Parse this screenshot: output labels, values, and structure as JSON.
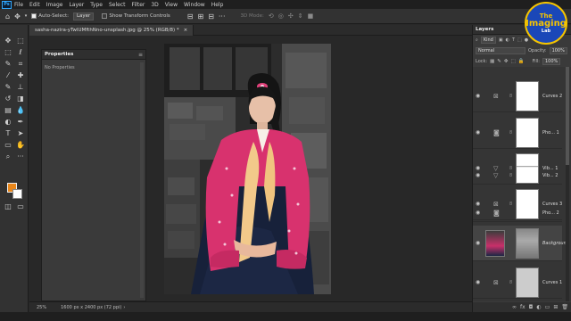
{
  "menubar": {
    "app_logo": "Ps",
    "items": [
      "File",
      "Edit",
      "Image",
      "Layer",
      "Type",
      "Select",
      "Filter",
      "3D",
      "View",
      "Window",
      "Help"
    ]
  },
  "options": {
    "auto_select_label": "Auto-Select:",
    "auto_select_value": "Layer",
    "show_transform_label": "Show Transform Controls",
    "mode_3d_label": "3D Mode:"
  },
  "document": {
    "tab_title": "sasha-nazira-yTwIUMfthNno-unsplash.jpg @ 25% (RGB/8) *",
    "tab_close": "×",
    "zoom": "25%",
    "doc_info": "1600 px x 2400 px (72 ppi)",
    "doc_info_arrow": "›"
  },
  "properties": {
    "tab_label": "Properties",
    "menu_glyph": "≡",
    "body_text": "No Properties"
  },
  "layers_panel": {
    "tab_label": "Layers",
    "kind_label": "Kind",
    "blend_mode": "Normal",
    "opacity_label": "Opacity:",
    "opacity_value": "100%",
    "lock_label": "Lock:",
    "fill_label": "Fill:",
    "fill_value": "100%",
    "layers": [
      {
        "name": "Curves 2",
        "icon": "curves-icon",
        "visible": true
      },
      {
        "name": "Pho... 1",
        "icon": "photo-filter-icon",
        "visible": true
      },
      {
        "name": "Vib... 1",
        "icon": "vibrance-icon",
        "visible": true
      },
      {
        "name": "Vib... 2",
        "icon": "vibrance-icon",
        "visible": true
      },
      {
        "name": "Curves 3",
        "icon": "curves-icon",
        "visible": true
      },
      {
        "name": "Pho... 2",
        "icon": "photo-filter-icon",
        "visible": true
      },
      {
        "name": "Background",
        "icon": "image-thumbnail",
        "visible": true
      },
      {
        "name": "Curves 1",
        "icon": "curves-icon",
        "visible": true
      }
    ]
  },
  "logo": {
    "line1": "The",
    "line2": "Imaging",
    "line3": "Lab"
  },
  "colors": {
    "foreground": "#e8861a",
    "background": "#ffffff",
    "accent": "#31a8ff"
  }
}
